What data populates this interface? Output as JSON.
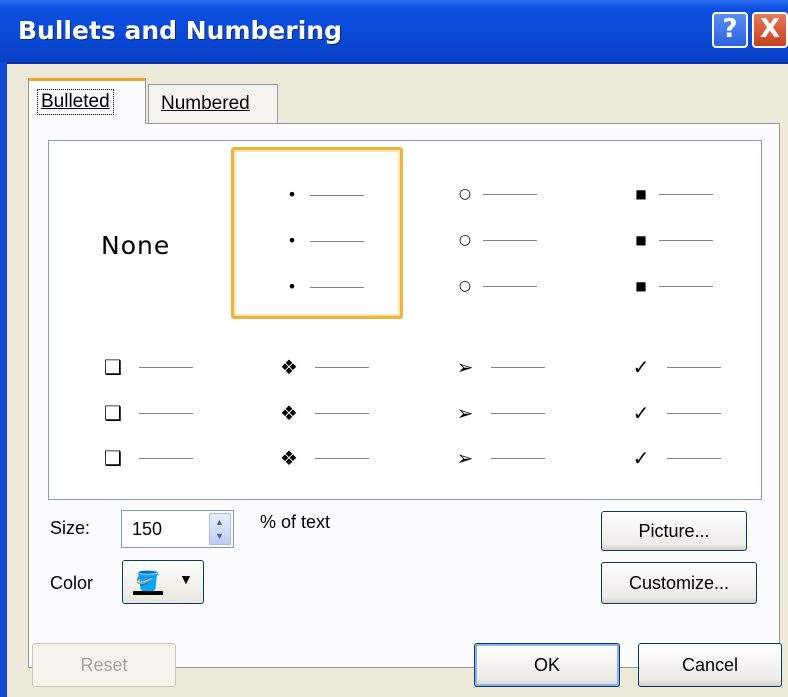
{
  "window": {
    "title": "Bullets and Numbering",
    "help_glyph": "?",
    "close_glyph": "X"
  },
  "tabs": [
    {
      "label": "Bulleted",
      "selected": true
    },
    {
      "label": "Numbered",
      "selected": false
    }
  ],
  "gallery": {
    "none_label": "None",
    "styles": [
      {
        "name": "none"
      },
      {
        "name": "small-dot",
        "glyph": "•",
        "selected": true
      },
      {
        "name": "hollow-circle",
        "glyph": "○"
      },
      {
        "name": "filled-square",
        "glyph": "■"
      },
      {
        "name": "hollow-square",
        "glyph": "❑"
      },
      {
        "name": "four-diamonds",
        "glyph": "❖"
      },
      {
        "name": "arrowhead",
        "glyph": "➢"
      },
      {
        "name": "checkmark",
        "glyph": "✓"
      }
    ]
  },
  "size": {
    "label": "Size:",
    "value": "150",
    "suffix": "% of text"
  },
  "color": {
    "label": "Color",
    "icon": "paint-bucket-icon",
    "swatch": "#000000"
  },
  "buttons": {
    "picture": "Picture...",
    "customize": "Customize...",
    "reset": "Reset",
    "ok": "OK",
    "cancel": "Cancel"
  },
  "colors": {
    "title_bar": "#0a49d6",
    "selection_border": "#f0b040",
    "dialog_bg": "#ece9d8"
  }
}
